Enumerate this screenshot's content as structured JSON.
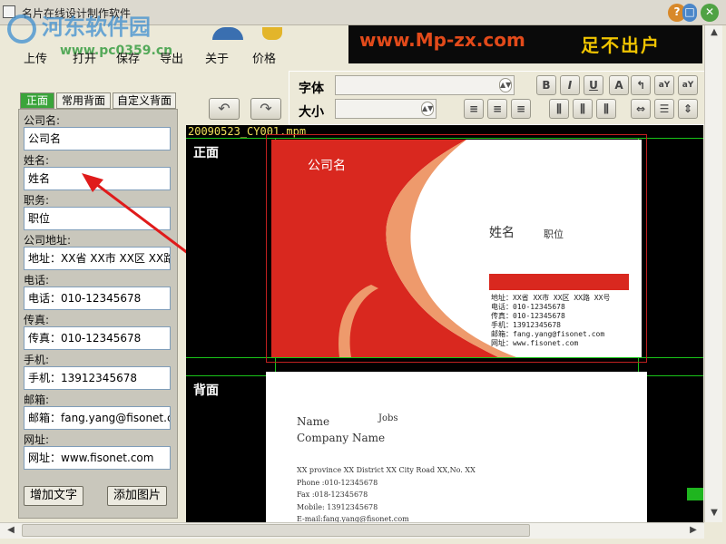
{
  "window": {
    "title": "名片在线设计制作软件"
  },
  "watermark": {
    "logo": "河东软件园",
    "url": "www.pc0359.cn"
  },
  "toolbar": {
    "items": [
      {
        "label": "上传",
        "icon": "upload-icon"
      },
      {
        "label": "打开",
        "icon": "open-icon"
      },
      {
        "label": "保存",
        "icon": "save-icon"
      },
      {
        "label": "导出",
        "icon": "export-icon"
      },
      {
        "label": "关于",
        "icon": "about-icon"
      },
      {
        "label": "价格",
        "icon": "price-icon"
      }
    ]
  },
  "banner": {
    "url": "www.Mp-zx.com",
    "motto": "足不出户"
  },
  "font_panel": {
    "font_label": "字体",
    "size_label": "大小",
    "font_value": "",
    "size_value": ""
  },
  "tabs": [
    {
      "label": "正面",
      "active": true
    },
    {
      "label": "常用背面",
      "active": false
    },
    {
      "label": "自定义背面",
      "active": false
    }
  ],
  "fields": [
    {
      "label": "公司名:",
      "value": "公司名"
    },
    {
      "label": "姓名:",
      "value": "姓名"
    },
    {
      "label": "职务:",
      "value": "职位"
    },
    {
      "label": "公司地址:",
      "value": "地址：XX省 XX市 XX区 XX路 XX号"
    },
    {
      "label": "电话:",
      "value": "电话：010-12345678"
    },
    {
      "label": "传真:",
      "value": "传真：010-12345678"
    },
    {
      "label": "手机:",
      "value": "手机：13912345678"
    },
    {
      "label": "邮箱:",
      "value": "邮箱：fang.yang@fisonet.com"
    },
    {
      "label": "网址:",
      "value": "网址：www.fisonet.com"
    }
  ],
  "buttons": {
    "add_text": "增加文字",
    "add_image": "添加图片"
  },
  "canvas": {
    "filename": "20090523_CY001.mpm",
    "front_label": "正面",
    "back_label": "背面"
  },
  "front_card": {
    "company": "公司名",
    "name": "姓名",
    "title": "职位",
    "contact_lines": [
      "地址：XX省 XX市 XX区 XX路 XX号",
      "电话：010-12345678",
      "传真：010-12345678",
      "手机：13912345678",
      "邮箱：fang.yang@fisonet.com",
      "网址：www.fisonet.com"
    ],
    "colors": {
      "red": "#d9281f",
      "accent": "#f0a070"
    }
  },
  "back_card": {
    "name": "Name",
    "title": "Jobs",
    "company": "Company Name",
    "lines": [
      "XX province XX District XX City Road XX,No. XX",
      "Phone :010-12345678",
      "Fax :018-12345678",
      "Mobile: 13912345678",
      "E-mail:fang.yang@fisonet.com"
    ]
  }
}
